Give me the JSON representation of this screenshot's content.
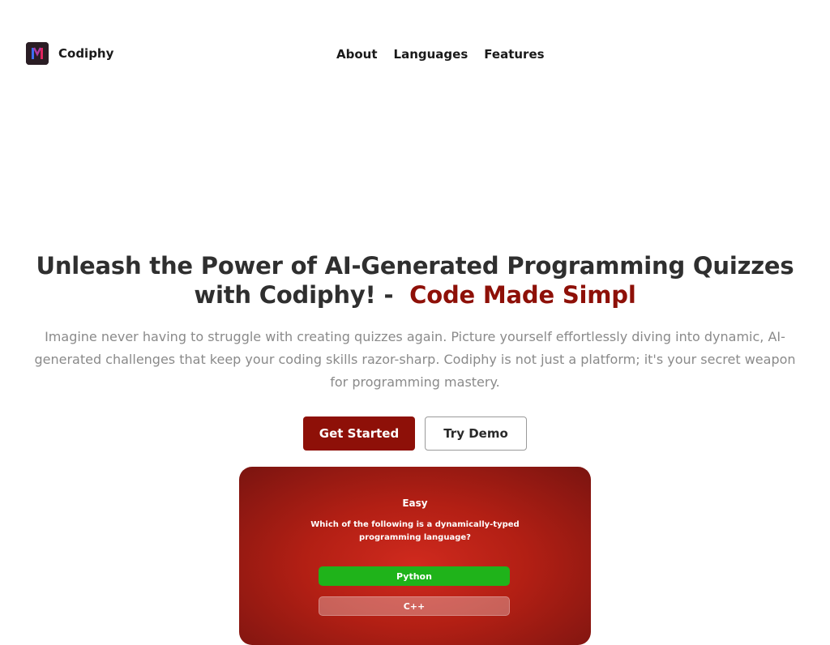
{
  "brand": {
    "name": "Codiphy",
    "logo_icon": "codiphy-logo-icon"
  },
  "nav": {
    "items": [
      {
        "label": "About"
      },
      {
        "label": "Languages"
      },
      {
        "label": "Features"
      }
    ]
  },
  "hero": {
    "title_main": "Unleash the Power of AI-Generated Programming Quizzes with Codiphy!",
    "title_separator": " - ",
    "title_accent": "Code Made Simpl",
    "description": "Imagine never having to struggle with creating quizzes again. Picture yourself effortlessly diving into dynamic, AI-generated challenges that keep your coding skills razor-sharp. Codiphy is not just a platform; it's your secret weapon for programming mastery."
  },
  "cta": {
    "primary_label": "Get Started",
    "secondary_label": "Try Demo"
  },
  "preview": {
    "level": "Easy",
    "question": "Which of the following is a dynamically-typed programming language?",
    "options": [
      {
        "label": "Python",
        "state": "correct"
      },
      {
        "label": "C++",
        "state": "neutral"
      }
    ]
  },
  "colors": {
    "accent": "#8e1008",
    "correct": "#1fb31a",
    "preview_bg": "#b21f14"
  }
}
